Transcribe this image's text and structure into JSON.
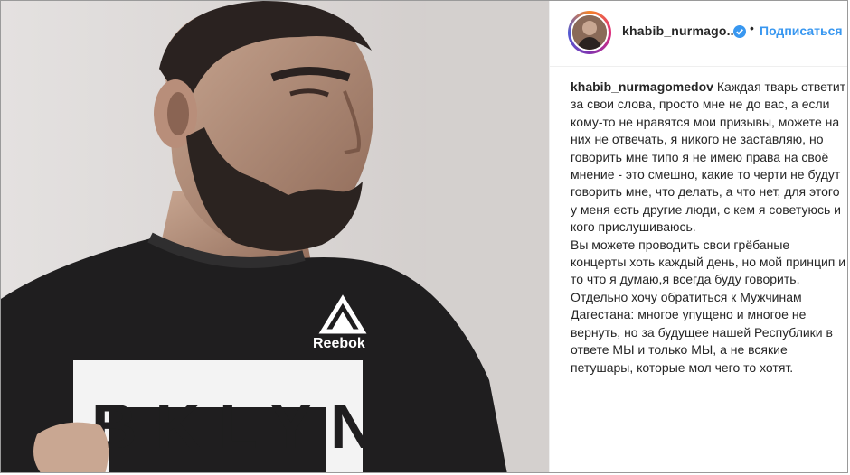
{
  "post": {
    "username": "khabib_nurmago...",
    "follow_label": "Подписаться",
    "separator": "•",
    "photo": {
      "shirt_brand": "Reebok",
      "shirt_print": "BKLYN"
    }
  },
  "caption": {
    "author": "khabib_nurmagomedov",
    "paragraph1": "Каждая тварь ответит за свои слова, просто мне не до вас, а если кому-то не нравятся мои призывы, можете на них не отвечать, я никого не заставляю, но говорить мне типо я не имею права на своё мнение - это смешно, какие то черти не будут говорить мне, что делать, а что нет, для этого у меня есть другие люди, с кем я советуюсь и кого прислушиваюсь.",
    "paragraph2": "Вы можете проводить свои грёбаные концерты хоть каждый день, но мой принцип и то что я думаю,я всегда буду говорить.",
    "paragraph3": "Отдельно хочу обратиться к Мужчинам Дагестана: многое упущено и многое не вернуть, но за будущее нашей Республики в ответе МЫ и только МЫ, а не всякие петушары, которые мол чего то хотят."
  },
  "colors": {
    "link_blue": "#3897f0",
    "text": "#262626",
    "verified_blue": "#3897f0"
  }
}
